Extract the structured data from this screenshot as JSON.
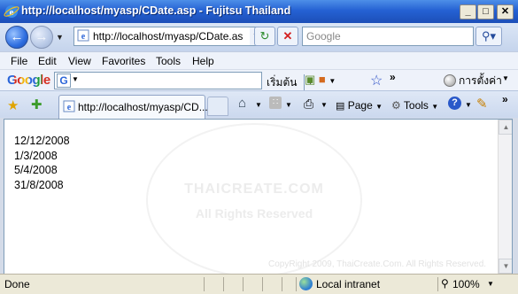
{
  "window": {
    "title": "http://localhost/myasp/CDate.asp - Fujitsu Thailand",
    "min_glyph": "_",
    "max_glyph": "□",
    "close_glyph": "✕"
  },
  "nav": {
    "address": "http://localhost/myasp/CDate.as",
    "search_placeholder": "Google"
  },
  "menu": [
    "File",
    "Edit",
    "View",
    "Favorites",
    "Tools",
    "Help"
  ],
  "google_toolbar": {
    "logo": "Google",
    "start_label": "เริ่มต้น",
    "settings_label": "การตั้งค่า"
  },
  "tab": {
    "label": "http://localhost/myasp/CD..."
  },
  "commands": {
    "page_label": "Page",
    "tools_label": "Tools"
  },
  "content": {
    "dates": [
      "12/12/2008",
      "1/3/2008",
      "5/4/2008",
      "31/8/2008"
    ],
    "watermark_line1": "THAICREATE.COM",
    "watermark_line2": "All Rights Reserved",
    "copyright": "CopyRight 2009, ThaiCreate.Com. All Rights Reserved."
  },
  "status": {
    "text": "Done",
    "zone": "Local intranet",
    "zoom": "100%"
  },
  "colors": {
    "title_bar": "#2561d3",
    "content_bg": "#ffffff",
    "chrome_bg": "#eef2fa"
  }
}
